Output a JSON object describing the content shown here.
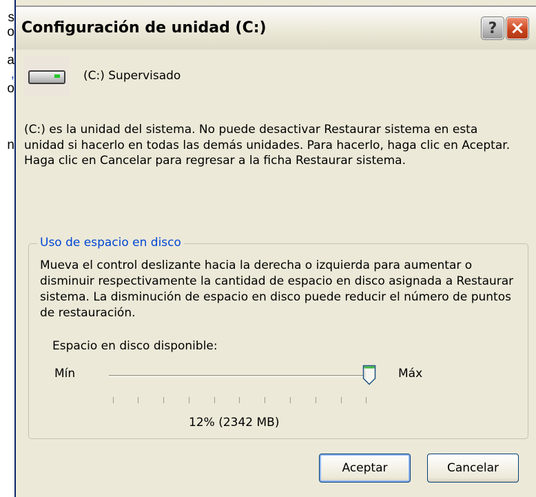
{
  "background": {
    "lines": [
      "s",
      "o",
      ",",
      "a",
      ",",
      "o",
      "n"
    ]
  },
  "dialog": {
    "title": "Configuración de unidad (C:)",
    "help_label": "?",
    "close_label": "×",
    "drive": {
      "icon": "hard-drive-icon",
      "label": "(C:) Supervisado"
    },
    "description": "(C:) es la unidad del sistema. No puede desactivar Restaurar sistema en esta unidad si hacerlo en todas las demás unidades. Para hacerlo, haga clic en Aceptar. Haga clic en Cancelar para regresar a la ficha Restaurar sistema.",
    "disk_usage": {
      "legend": "Uso de espacio en disco",
      "text": "Mueva el control deslizante hacia la derecha o izquierda para aumentar o disminuir respectivamente la cantidad de espacio en disco asignada a Restaurar sistema. La disminución de espacio en disco puede reducir el número de puntos de restauración.",
      "available_label": "Espacio en disco disponible:",
      "min_label": "Mín",
      "max_label": "Máx",
      "value_percent": 12,
      "value_text": "12% (2342 MB)"
    },
    "buttons": {
      "ok": "Aceptar",
      "cancel": "Cancelar"
    }
  },
  "colors": {
    "dialog_bg": "#ece9d8",
    "legend": "#0046d5",
    "close_button": "#c7431c"
  }
}
